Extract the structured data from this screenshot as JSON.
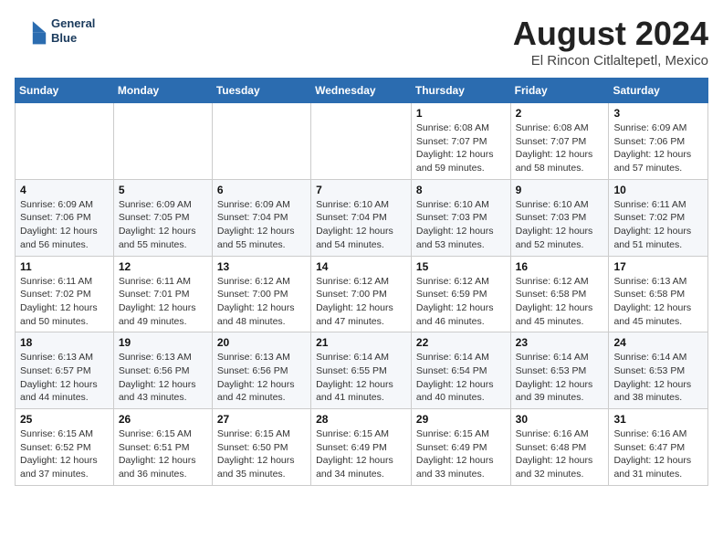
{
  "header": {
    "logo_line1": "General",
    "logo_line2": "Blue",
    "month_year": "August 2024",
    "location": "El Rincon Citlaltepetl, Mexico"
  },
  "weekdays": [
    "Sunday",
    "Monday",
    "Tuesday",
    "Wednesday",
    "Thursday",
    "Friday",
    "Saturday"
  ],
  "weeks": [
    [
      {
        "day": "",
        "info": ""
      },
      {
        "day": "",
        "info": ""
      },
      {
        "day": "",
        "info": ""
      },
      {
        "day": "",
        "info": ""
      },
      {
        "day": "1",
        "info": "Sunrise: 6:08 AM\nSunset: 7:07 PM\nDaylight: 12 hours\nand 59 minutes."
      },
      {
        "day": "2",
        "info": "Sunrise: 6:08 AM\nSunset: 7:07 PM\nDaylight: 12 hours\nand 58 minutes."
      },
      {
        "day": "3",
        "info": "Sunrise: 6:09 AM\nSunset: 7:06 PM\nDaylight: 12 hours\nand 57 minutes."
      }
    ],
    [
      {
        "day": "4",
        "info": "Sunrise: 6:09 AM\nSunset: 7:06 PM\nDaylight: 12 hours\nand 56 minutes."
      },
      {
        "day": "5",
        "info": "Sunrise: 6:09 AM\nSunset: 7:05 PM\nDaylight: 12 hours\nand 55 minutes."
      },
      {
        "day": "6",
        "info": "Sunrise: 6:09 AM\nSunset: 7:04 PM\nDaylight: 12 hours\nand 55 minutes."
      },
      {
        "day": "7",
        "info": "Sunrise: 6:10 AM\nSunset: 7:04 PM\nDaylight: 12 hours\nand 54 minutes."
      },
      {
        "day": "8",
        "info": "Sunrise: 6:10 AM\nSunset: 7:03 PM\nDaylight: 12 hours\nand 53 minutes."
      },
      {
        "day": "9",
        "info": "Sunrise: 6:10 AM\nSunset: 7:03 PM\nDaylight: 12 hours\nand 52 minutes."
      },
      {
        "day": "10",
        "info": "Sunrise: 6:11 AM\nSunset: 7:02 PM\nDaylight: 12 hours\nand 51 minutes."
      }
    ],
    [
      {
        "day": "11",
        "info": "Sunrise: 6:11 AM\nSunset: 7:02 PM\nDaylight: 12 hours\nand 50 minutes."
      },
      {
        "day": "12",
        "info": "Sunrise: 6:11 AM\nSunset: 7:01 PM\nDaylight: 12 hours\nand 49 minutes."
      },
      {
        "day": "13",
        "info": "Sunrise: 6:12 AM\nSunset: 7:00 PM\nDaylight: 12 hours\nand 48 minutes."
      },
      {
        "day": "14",
        "info": "Sunrise: 6:12 AM\nSunset: 7:00 PM\nDaylight: 12 hours\nand 47 minutes."
      },
      {
        "day": "15",
        "info": "Sunrise: 6:12 AM\nSunset: 6:59 PM\nDaylight: 12 hours\nand 46 minutes."
      },
      {
        "day": "16",
        "info": "Sunrise: 6:12 AM\nSunset: 6:58 PM\nDaylight: 12 hours\nand 45 minutes."
      },
      {
        "day": "17",
        "info": "Sunrise: 6:13 AM\nSunset: 6:58 PM\nDaylight: 12 hours\nand 45 minutes."
      }
    ],
    [
      {
        "day": "18",
        "info": "Sunrise: 6:13 AM\nSunset: 6:57 PM\nDaylight: 12 hours\nand 44 minutes."
      },
      {
        "day": "19",
        "info": "Sunrise: 6:13 AM\nSunset: 6:56 PM\nDaylight: 12 hours\nand 43 minutes."
      },
      {
        "day": "20",
        "info": "Sunrise: 6:13 AM\nSunset: 6:56 PM\nDaylight: 12 hours\nand 42 minutes."
      },
      {
        "day": "21",
        "info": "Sunrise: 6:14 AM\nSunset: 6:55 PM\nDaylight: 12 hours\nand 41 minutes."
      },
      {
        "day": "22",
        "info": "Sunrise: 6:14 AM\nSunset: 6:54 PM\nDaylight: 12 hours\nand 40 minutes."
      },
      {
        "day": "23",
        "info": "Sunrise: 6:14 AM\nSunset: 6:53 PM\nDaylight: 12 hours\nand 39 minutes."
      },
      {
        "day": "24",
        "info": "Sunrise: 6:14 AM\nSunset: 6:53 PM\nDaylight: 12 hours\nand 38 minutes."
      }
    ],
    [
      {
        "day": "25",
        "info": "Sunrise: 6:15 AM\nSunset: 6:52 PM\nDaylight: 12 hours\nand 37 minutes."
      },
      {
        "day": "26",
        "info": "Sunrise: 6:15 AM\nSunset: 6:51 PM\nDaylight: 12 hours\nand 36 minutes."
      },
      {
        "day": "27",
        "info": "Sunrise: 6:15 AM\nSunset: 6:50 PM\nDaylight: 12 hours\nand 35 minutes."
      },
      {
        "day": "28",
        "info": "Sunrise: 6:15 AM\nSunset: 6:49 PM\nDaylight: 12 hours\nand 34 minutes."
      },
      {
        "day": "29",
        "info": "Sunrise: 6:15 AM\nSunset: 6:49 PM\nDaylight: 12 hours\nand 33 minutes."
      },
      {
        "day": "30",
        "info": "Sunrise: 6:16 AM\nSunset: 6:48 PM\nDaylight: 12 hours\nand 32 minutes."
      },
      {
        "day": "31",
        "info": "Sunrise: 6:16 AM\nSunset: 6:47 PM\nDaylight: 12 hours\nand 31 minutes."
      }
    ]
  ]
}
